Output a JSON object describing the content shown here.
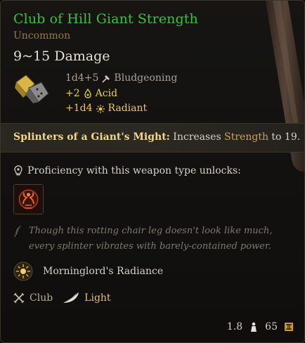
{
  "item": {
    "title": "Club of Hill Giant Strength",
    "rarity": "Uncommon",
    "damage": "9~15 Damage",
    "damage_lines": [
      {
        "value": "1d4+5",
        "type": "Bludgeoning"
      },
      {
        "value": "+2",
        "type": "Acid"
      },
      {
        "value": "+1d4",
        "type": "Radiant"
      }
    ]
  },
  "passive": {
    "name": "Splinters of a Giant's Might:",
    "text_before": " Increases ",
    "stat": "Strength",
    "text_after": " to 19."
  },
  "proficiency": {
    "label": "Proficiency with this weapon type unlocks:"
  },
  "flavor": {
    "text": "Though this rotting chair leg doesn't look like much, every splinter vibrates with barely-contained power."
  },
  "special": {
    "name": "Morninglord's Radiance"
  },
  "properties": {
    "weapon_type": "Club",
    "weight_class": "Light"
  },
  "footer": {
    "weight": "1.8",
    "value": "65"
  },
  "colors": {
    "title": "#3fbf3f",
    "rarity": "#8f7a52",
    "passive_name": "#f2d88f",
    "acid": "#e8d34a",
    "radiant": "#f0c84e"
  },
  "icons": {
    "dice": "dice-icon",
    "bludgeoning": "hammer-icon",
    "acid": "acid-icon",
    "radiant": "sun-icon",
    "proficiency": "bulb-icon",
    "action": "topple-icon",
    "flavor": "feather-quill-icon",
    "special": "radiance-icon",
    "weapon_type": "crossed-swords-icon",
    "weight_class": "feather-icon",
    "weight": "weight-icon",
    "value": "coin-icon"
  }
}
